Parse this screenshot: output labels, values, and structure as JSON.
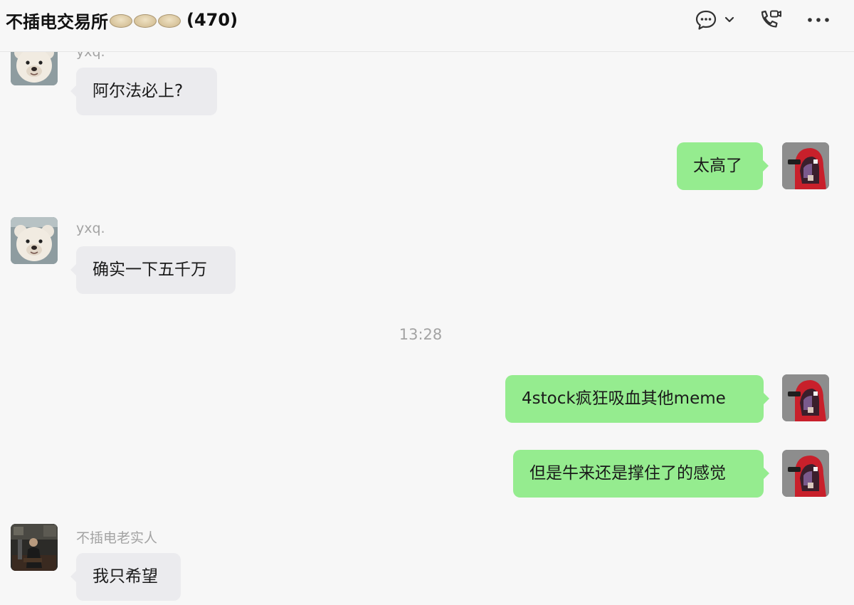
{
  "header": {
    "title": "不插电交易所",
    "member_count": "(470)",
    "title_emoji": "dumpling-emoji",
    "icons": [
      "chat-bubble-icon",
      "chevron-down-icon",
      "phone-video-icon",
      "more-icon"
    ]
  },
  "messages": [
    {
      "side": "left",
      "sender": "yxq.",
      "text": "阿尔法必上?",
      "avatar": "teddy-bear-avatar"
    },
    {
      "side": "right",
      "text": "太高了",
      "avatar": "red-hood-avatar"
    },
    {
      "side": "left",
      "sender": "yxq.",
      "text": "确实一下五千万",
      "avatar": "teddy-bear-avatar"
    },
    {
      "type": "timestamp",
      "text": "13:28"
    },
    {
      "side": "right",
      "text": "4stock疯狂吸血其他meme",
      "avatar": "red-hood-avatar"
    },
    {
      "side": "right",
      "text": "但是牛来还是撑住了的感觉",
      "avatar": "red-hood-avatar"
    },
    {
      "side": "left",
      "sender": "不插电老实人",
      "text": "我只希望",
      "avatar": "man-avatar"
    }
  ],
  "colors": {
    "background": "#f7f7f7",
    "outgoing_bubble": "#95ec8f",
    "incoming_bubble": "#ebebee",
    "muted_text": "#a3a3a3"
  }
}
